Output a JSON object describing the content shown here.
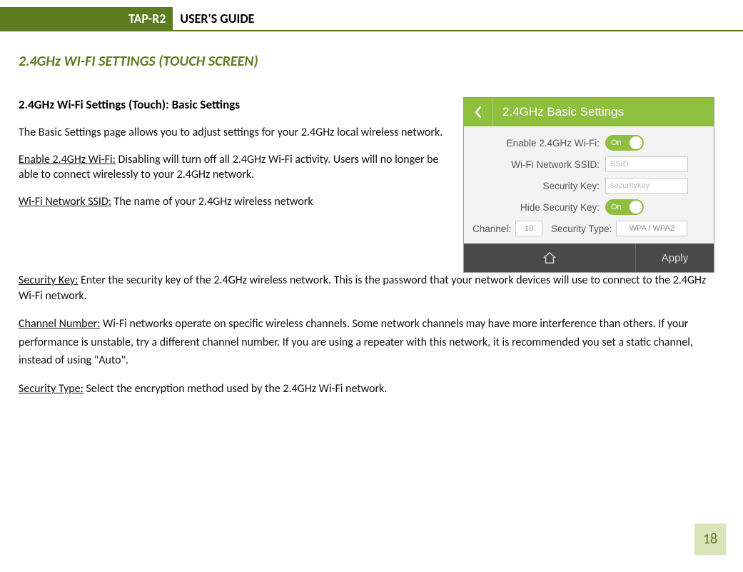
{
  "header": {
    "product": "TAP-R2",
    "title": "USER'S GUIDE"
  },
  "section_title": "2.4GHz WI-FI SETTINGS (TOUCH SCREEN)",
  "subhead": "2.4GHz Wi-Fi Settings (Touch): Basic Settings",
  "intro": "The Basic Settings page allows you to adjust settings for your 2.4GHz local wireless network.",
  "defs": {
    "enable": {
      "term": "Enable 2.4GHz Wi-Fi:",
      "text": " Disabling will turn off all 2.4GHz Wi-Fi activity.  Users will no longer be able to connect wirelessly to your 2.4GHz network."
    },
    "ssid": {
      "term": "Wi-Fi Network SSID:",
      "text": " The name of your 2.4GHz wireless network"
    },
    "seckey": {
      "term": "Security Key:",
      "text": " Enter the security key of the 2.4GHz wireless network. This is the password that your network devices will use to connect to the 2.4GHz Wi-Fi network."
    },
    "channel": {
      "term": "Channel Number:",
      "text": "  Wi-Fi networks operate on specific wireless channels. Some network channels may have more interference than others. If your performance is unstable, try a different channel number. If you are using a repeater with this network, it is recommended you set a static channel, instead of using \"Auto\"."
    },
    "sectype": {
      "term": "Security Type:",
      "text": " Select the encryption method used by the 2.4GHz Wi-Fi network."
    }
  },
  "mock": {
    "title": "2.4GHz Basic Settings",
    "rows": {
      "enable": "Enable 2.4GHz Wi-Fi:",
      "ssid": "Wi-Fi Network SSID:",
      "seckey": "Security Key:",
      "hidekey": "Hide Security Key:"
    },
    "toggle_on": "On",
    "ssid_placeholder": "SSID",
    "seckey_placeholder": "securitykey",
    "channel_label": "Channel:",
    "channel_value": "10",
    "sectype_label": "Security Type:",
    "sectype_value": "WPA / WPA2",
    "apply": "Apply"
  },
  "page_number": "18"
}
